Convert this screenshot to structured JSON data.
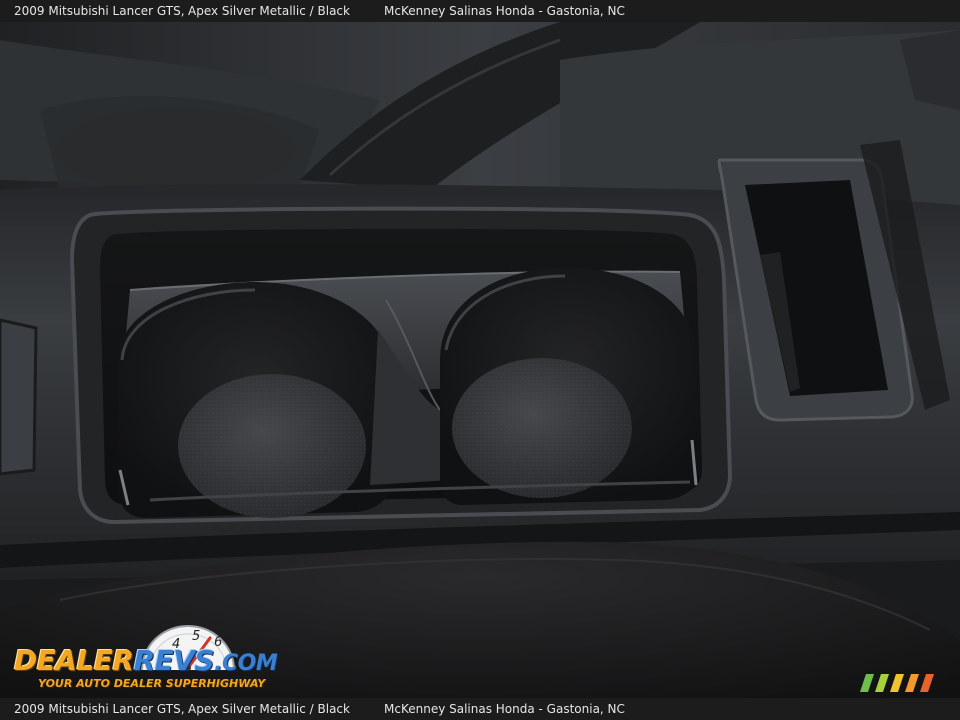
{
  "caption": {
    "model": "2009 Mitsubishi Lancer GTS,",
    "color": "Apex Silver Metallic / Black",
    "dealer": "McKenney Salinas Honda - Gastonia, NC"
  },
  "caption_bottom": {
    "model": "2009 Mitsubishi Lancer GTS,",
    "color": "Apex Silver Metallic / Black",
    "dealer": "McKenney Salinas Honda - Gastonia, NC"
  },
  "logo": {
    "dealer": "DEALER",
    "revs": "REVS",
    "com": ".COM",
    "tagline": "YOUR AUTO DEALER SUPERHIGHWAY",
    "gauge_digits": [
      "4",
      "5",
      "6"
    ]
  },
  "colors": {
    "console": "#2e3033",
    "cup_bottom": "#3a3c40",
    "seat": "#1b1b1d",
    "logo_orange": "#f3a722",
    "logo_blue": "#3a7fd0",
    "stripe_colors": [
      "#6cc04a",
      "#a6d13b",
      "#f2c230",
      "#f29a2e",
      "#e8632b"
    ]
  },
  "icons": {
    "gauge": "speedometer-icon",
    "stripes": "color-stripes-icon"
  }
}
